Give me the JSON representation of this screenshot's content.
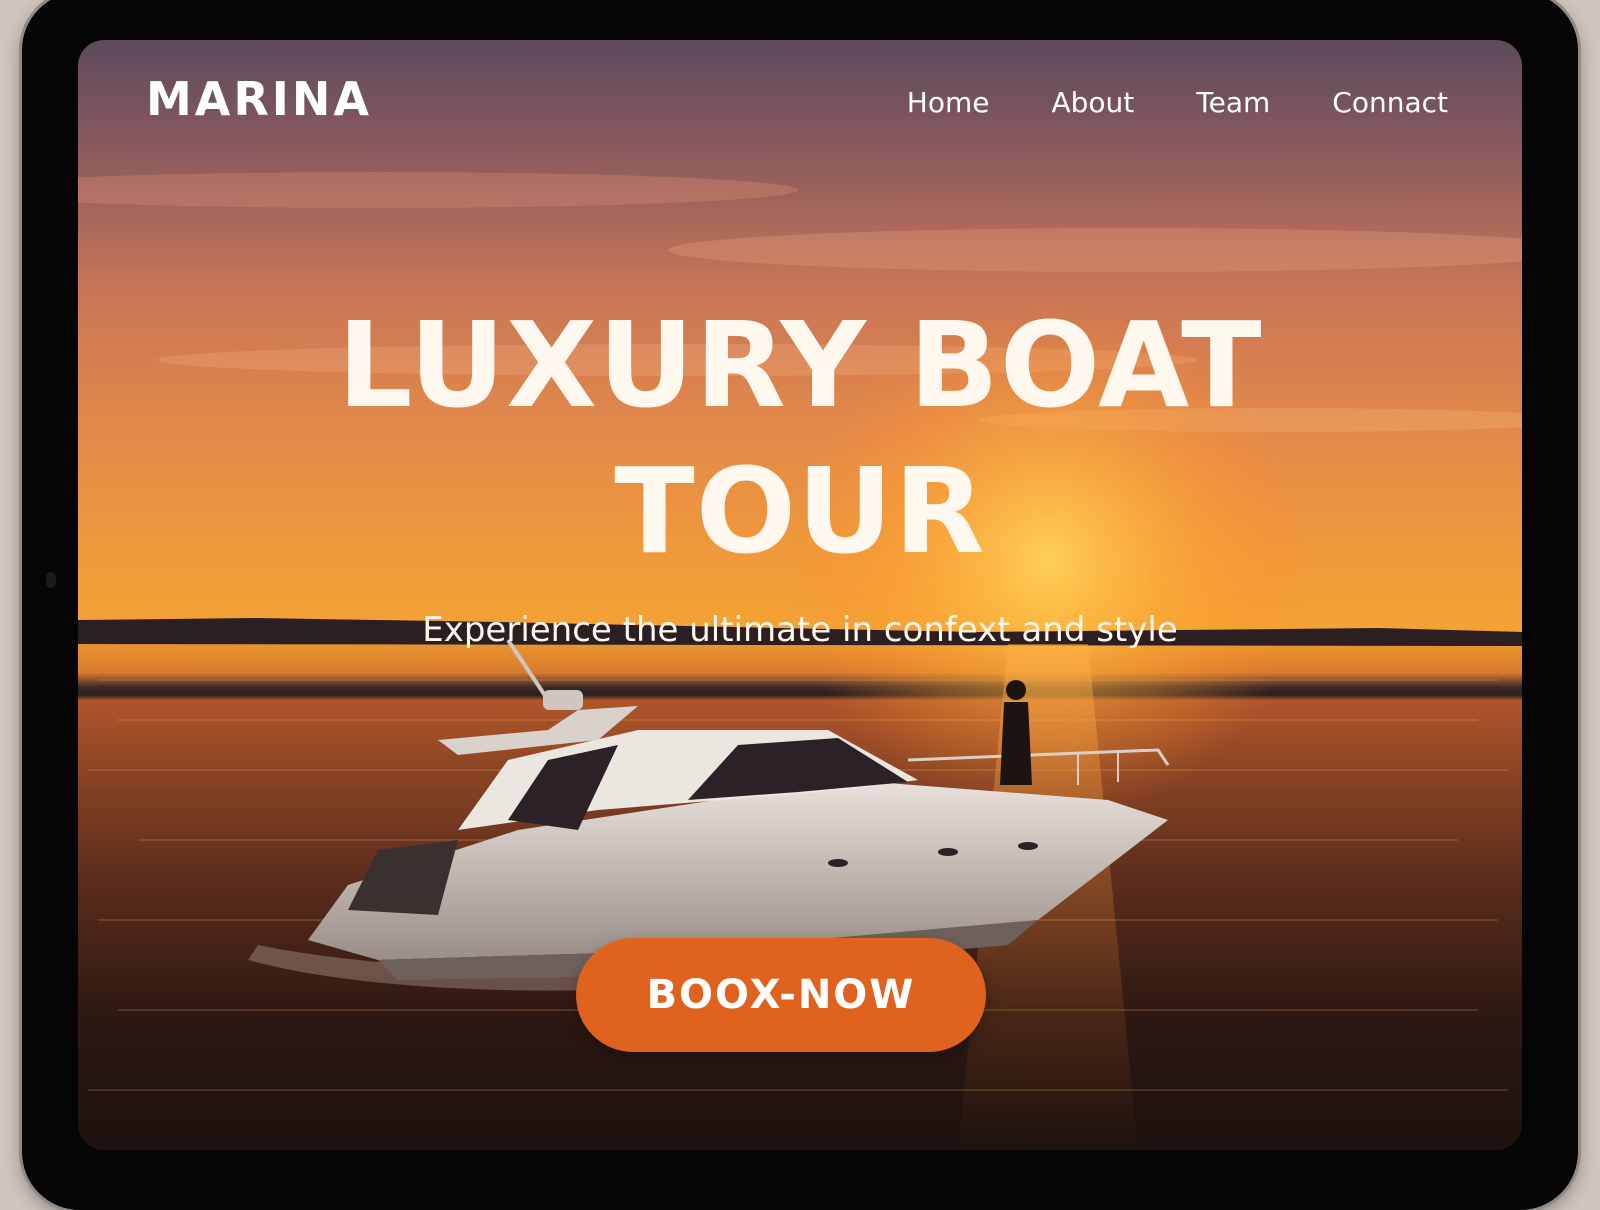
{
  "brand": {
    "name": "MARINA"
  },
  "nav": {
    "items": [
      {
        "label": "Home"
      },
      {
        "label": "About"
      },
      {
        "label": "Team"
      },
      {
        "label": "Connact"
      }
    ]
  },
  "hero": {
    "title_line1": "LUXURY BOAT",
    "title_line2": "TOUR",
    "subtitle": "Experience the ultimate in confext and style",
    "cta_label": "BOOX-NOW"
  },
  "colors": {
    "cta": "#e0621f",
    "text": "#ffffff",
    "bezel": "#050505"
  }
}
